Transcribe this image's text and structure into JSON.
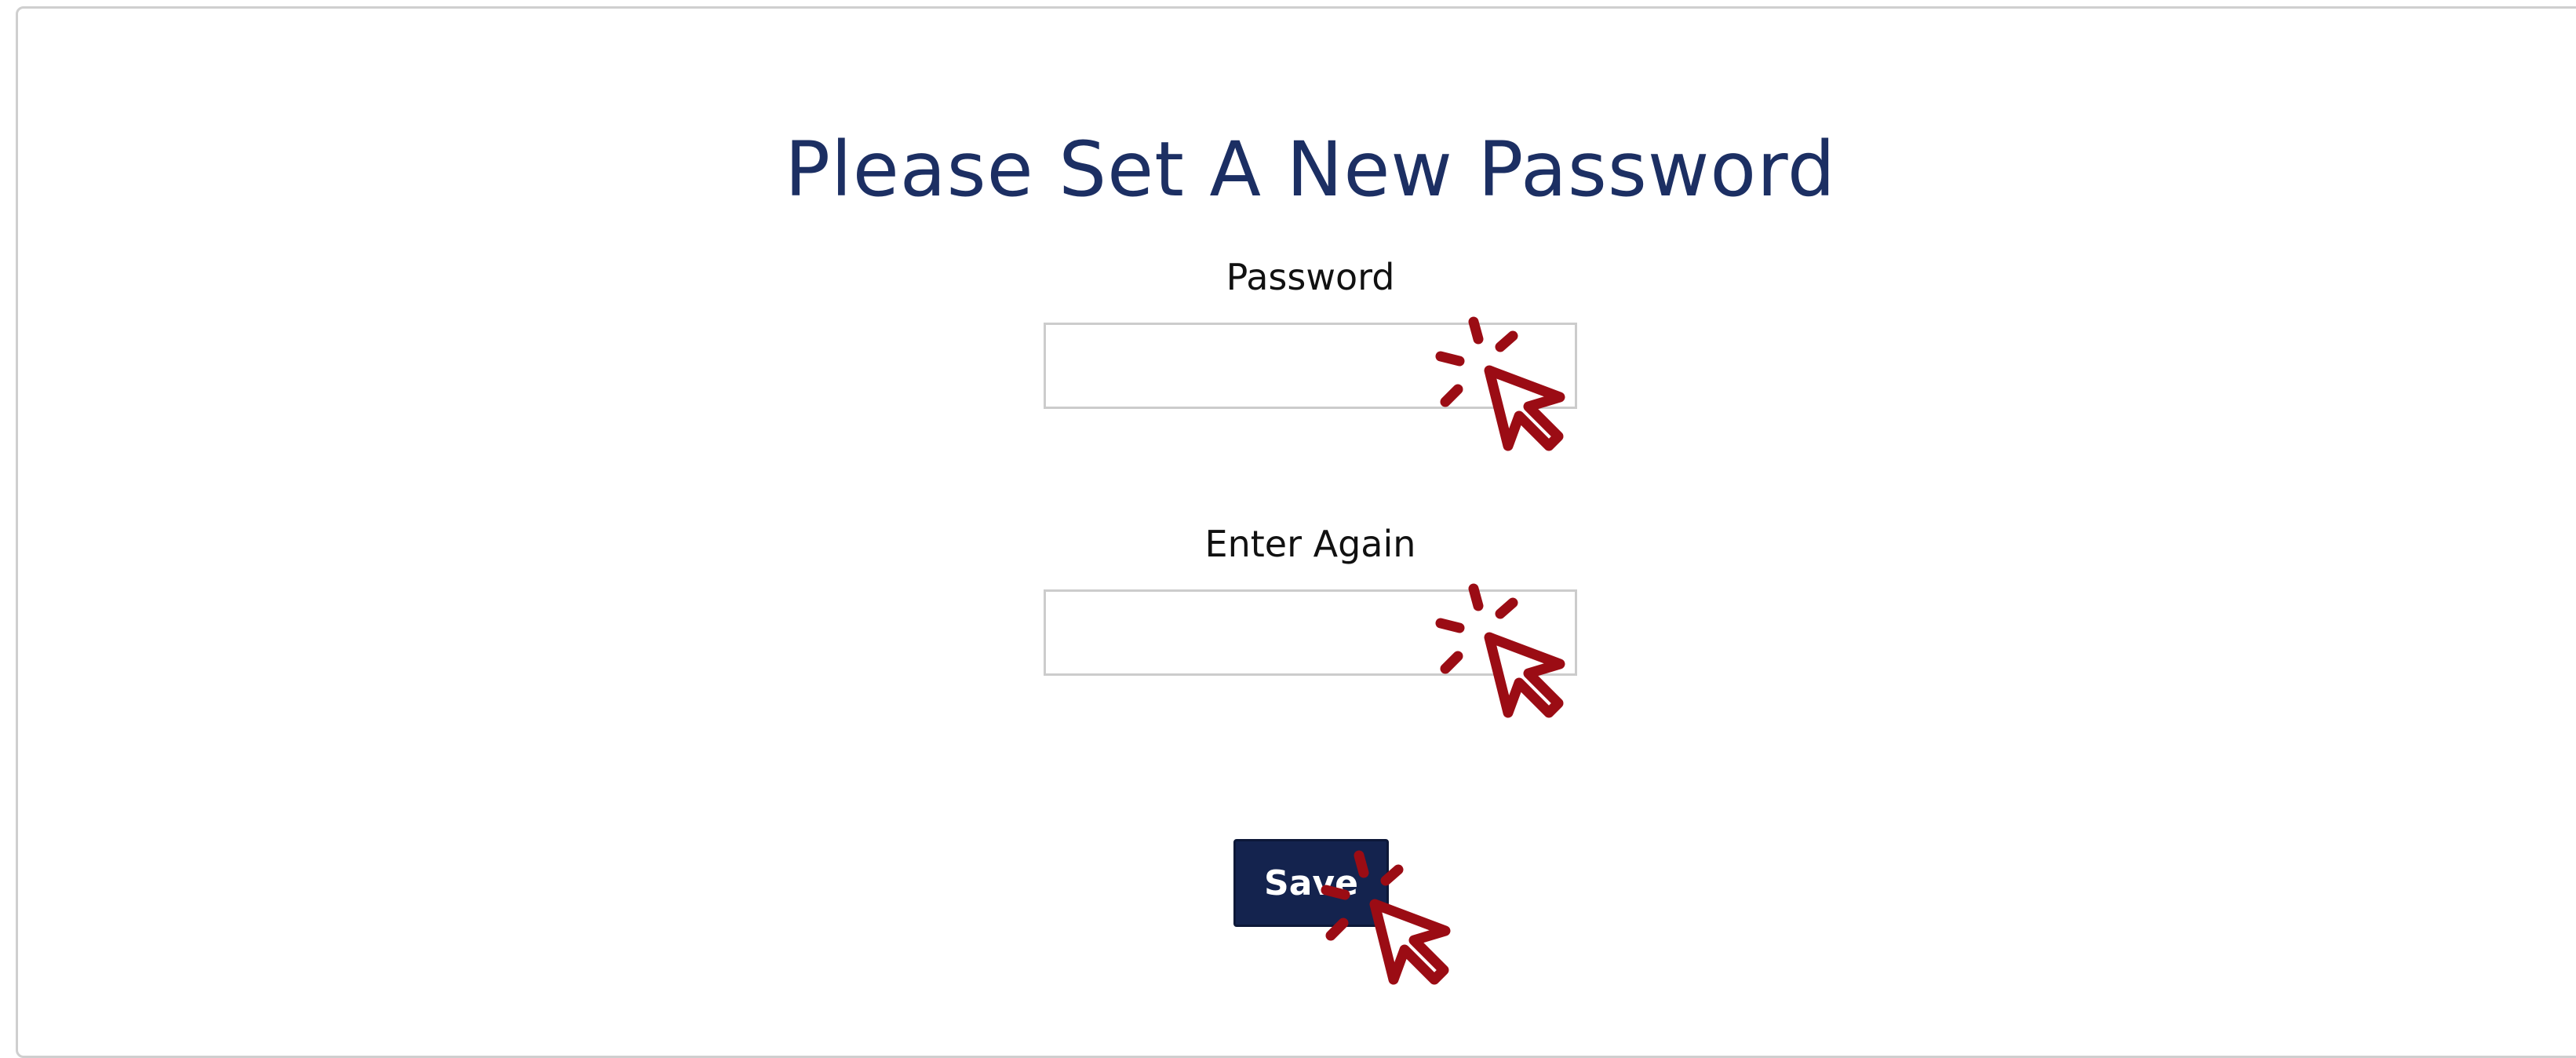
{
  "form": {
    "title": "Please Set A New Password",
    "password_label": "Password",
    "confirm_label": "Enter Again",
    "password_value": "",
    "confirm_value": "",
    "save_label": "Save"
  },
  "annotations": {
    "cursor_icon": "click-cursor-icon",
    "cursor_color": "#9b0c14"
  },
  "colors": {
    "title": "#1c2f63",
    "button_bg": "#14234e",
    "field_border": "#cccccc"
  }
}
